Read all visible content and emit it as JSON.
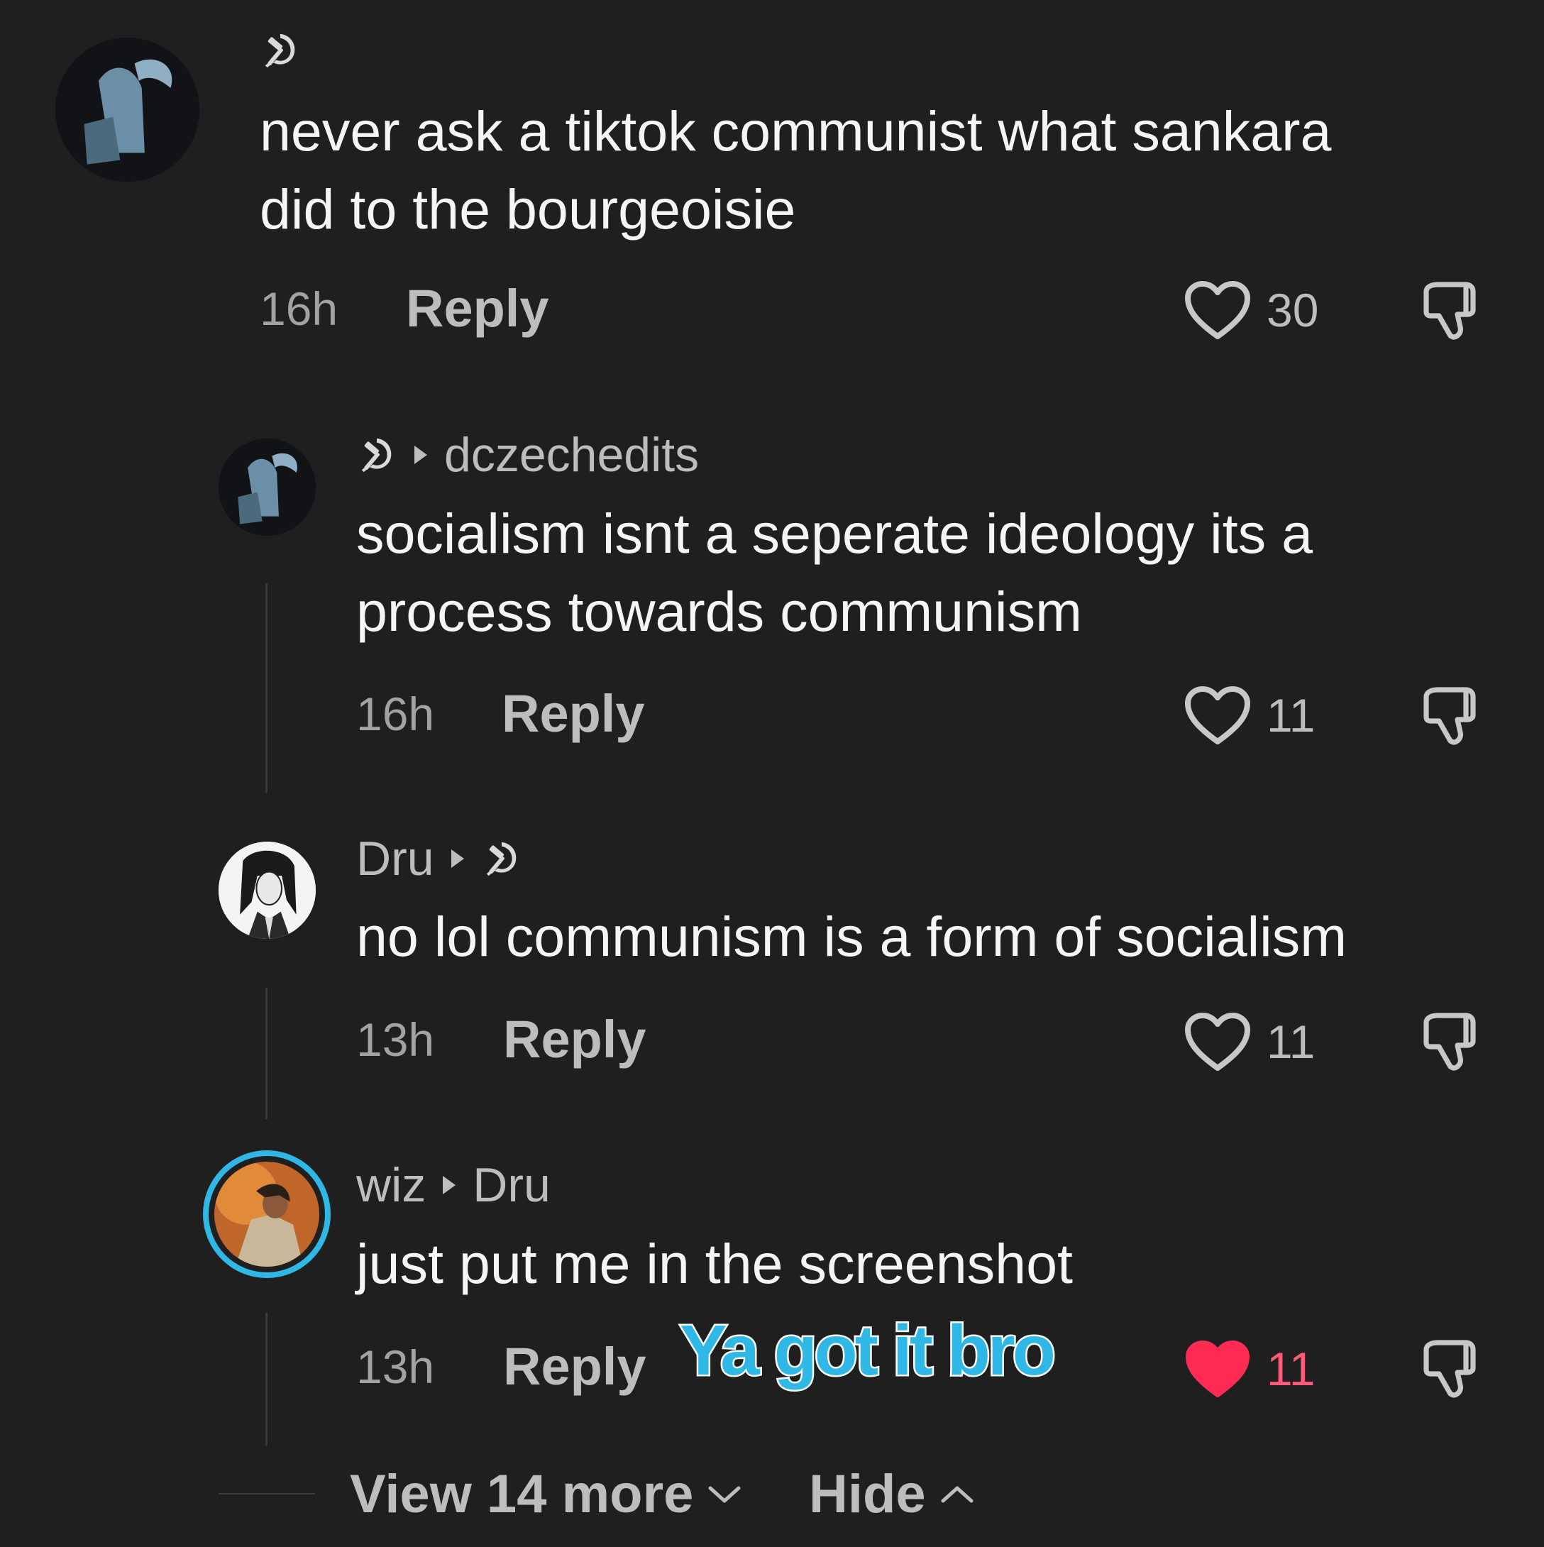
{
  "colors": {
    "background": "#1f1f1f",
    "text": "#f5f5f5",
    "muted": "#a2a2a2",
    "liked": "#ff2b55",
    "overlay": "#2fb8e6",
    "story_ring": "#2fb8e6"
  },
  "comments": [
    {
      "author_icon": "hammer-sickle-icon",
      "text_lines": [
        "never ask a tiktok communist what sankara",
        "did to the bourgeoisie"
      ],
      "time": "16h",
      "reply_label": "Reply",
      "likes": "30",
      "liked": false
    },
    {
      "author_icon": "hammer-sickle-icon",
      "reply_to": "dczechedits",
      "text_lines": [
        "socialism isnt a seperate ideology its a",
        "process towards communism"
      ],
      "time": "16h",
      "reply_label": "Reply",
      "likes": "11",
      "liked": false
    },
    {
      "author": "Dru",
      "reply_to_icon": "hammer-sickle-icon",
      "text_lines": [
        "no lol communism is a form of socialism"
      ],
      "time": "13h",
      "reply_label": "Reply",
      "likes": "11",
      "liked": false
    },
    {
      "author": "wiz",
      "reply_to": "Dru",
      "text_lines": [
        "just put me in the screenshot"
      ],
      "time": "13h",
      "reply_label": "Reply",
      "likes": "11",
      "liked": true
    }
  ],
  "overlay_caption": "Ya got it bro",
  "footer": {
    "view_more": "View 14 more",
    "hide": "Hide"
  }
}
